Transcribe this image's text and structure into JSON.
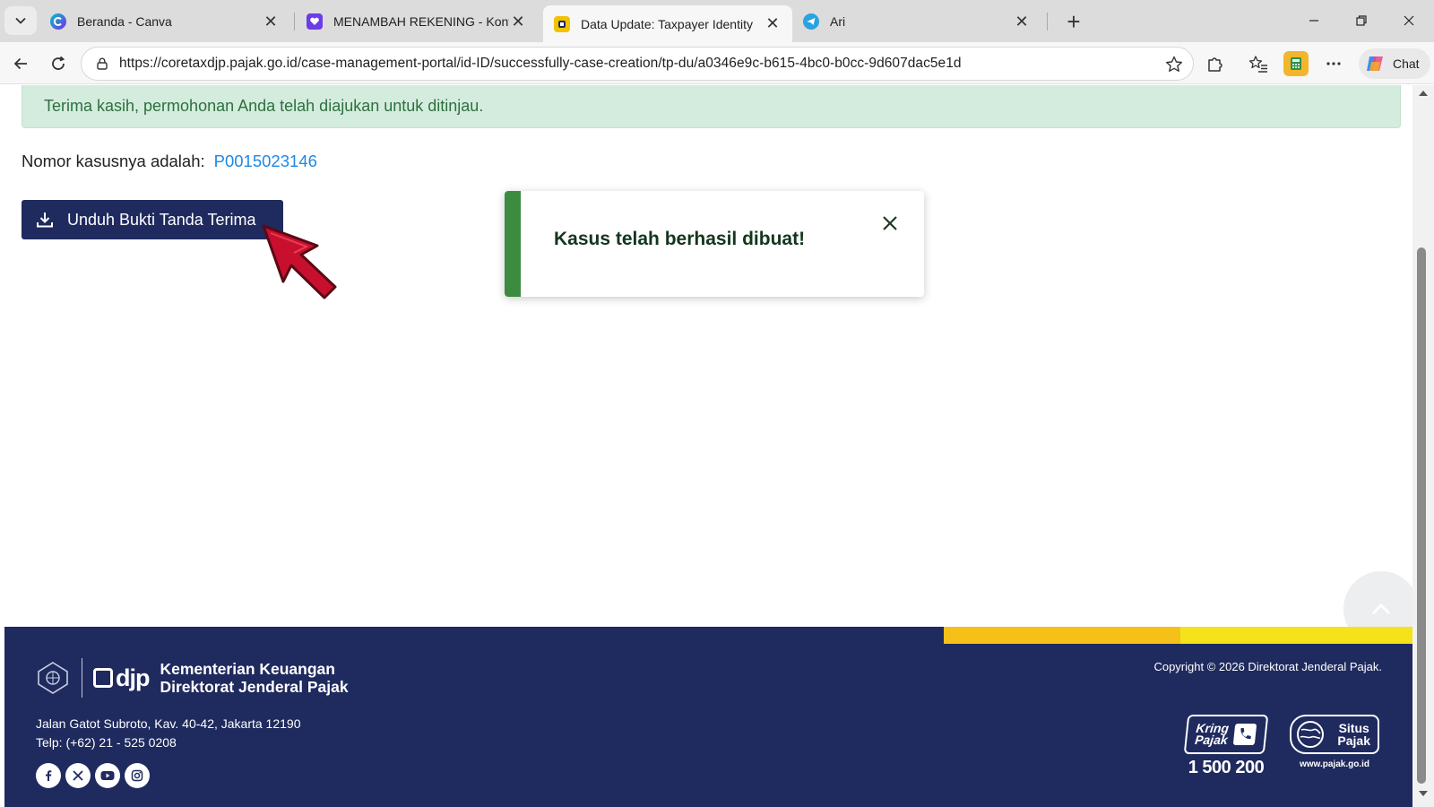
{
  "browser": {
    "tabs": [
      {
        "title": "Beranda - Canva",
        "icon": "canva-icon",
        "active": false
      },
      {
        "title": "MENAMBAH REKENING - Konten T",
        "icon": "heart-chat-icon",
        "active": false
      },
      {
        "title": "Data Update: Taxpayer Identity",
        "icon": "coretax-icon",
        "active": true
      },
      {
        "title": "Ari",
        "icon": "telegram-icon",
        "active": false
      }
    ],
    "close_glyph": "✕",
    "new_tab_glyph": "+",
    "url": "https://coretaxdjp.pajak.go.id/case-management-portal/id-ID/successfully-case-creation/tp-du/a0346e9c-b615-4bc0-b0cc-9d607dac5e1d",
    "chat_label": "Chat"
  },
  "page": {
    "banner_text": "Terima kasih, permohonan Anda telah diajukan untuk ditinjau.",
    "case_label": "Nomor kasusnya adalah:",
    "case_number": "P0015023146",
    "download_label": "Unduh Bukti Tanda Terima"
  },
  "toast": {
    "message": "Kasus telah berhasil dibuat!"
  },
  "footer": {
    "org_line1": "Kementerian Keuangan",
    "org_line2": "Direktorat Jenderal Pajak",
    "djp_mark": "djp",
    "address": "Jalan Gatot Subroto, Kav. 40-42, Jakarta 12190",
    "phone": "Telp: (+62) 21 - 525 0208",
    "copyright": "Copyright © 2026 Direktorat Jenderal Pajak.",
    "kring_line1": "Kring",
    "kring_line2": "Pajak",
    "kring_number": "1 500 200",
    "situs_line1": "Situs",
    "situs_line2": "Pajak",
    "situs_url": "www.pajak.go.id",
    "socials": [
      "facebook-icon",
      "x-icon",
      "youtube-icon",
      "instagram-icon"
    ]
  },
  "colors": {
    "navy": "#1f2a5e",
    "success_green": "#3d8b40",
    "banner_bg": "#d4ecdd",
    "link_blue": "#1e88e5",
    "strip_yellow_a": "#f5c119",
    "strip_yellow_b": "#f6e21b",
    "cursor_red": "#c8102e"
  }
}
